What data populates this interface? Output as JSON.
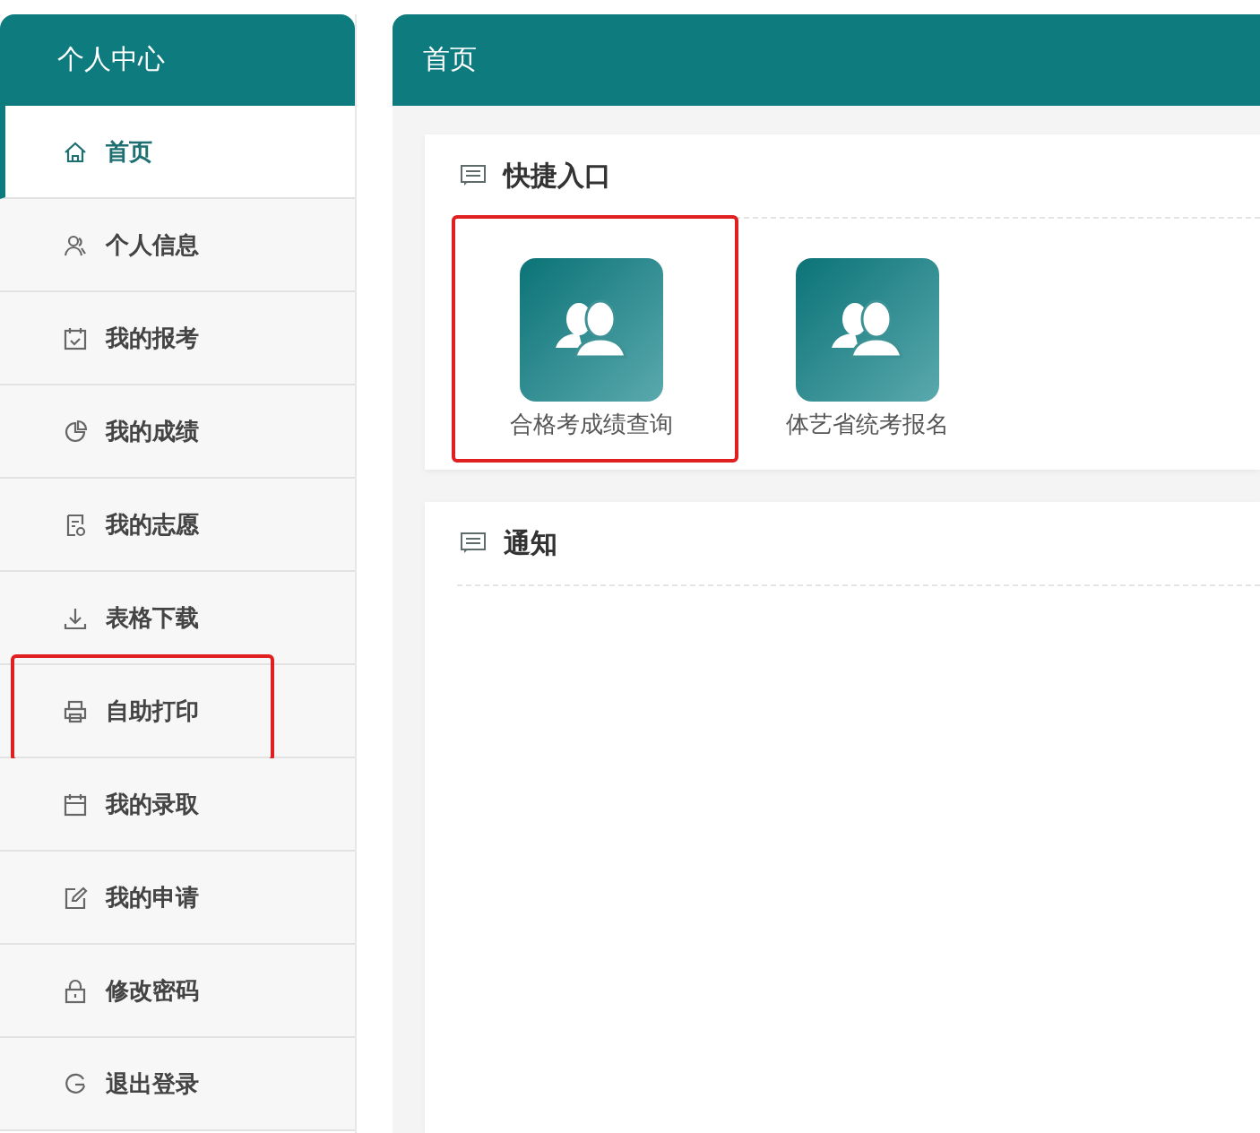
{
  "sidebar": {
    "title": "个人中心",
    "items": [
      {
        "label": "首页",
        "selected": true,
        "highlighted": false
      },
      {
        "label": "个人信息",
        "selected": false,
        "highlighted": false
      },
      {
        "label": "我的报考",
        "selected": false,
        "highlighted": false
      },
      {
        "label": "我的成绩",
        "selected": false,
        "highlighted": false
      },
      {
        "label": "我的志愿",
        "selected": false,
        "highlighted": false
      },
      {
        "label": "表格下载",
        "selected": false,
        "highlighted": false
      },
      {
        "label": "自助打印",
        "selected": false,
        "highlighted": true
      },
      {
        "label": "我的录取",
        "selected": false,
        "highlighted": false
      },
      {
        "label": "我的申请",
        "selected": false,
        "highlighted": false
      },
      {
        "label": "修改密码",
        "selected": false,
        "highlighted": false
      },
      {
        "label": "退出登录",
        "selected": false,
        "highlighted": false
      }
    ]
  },
  "main": {
    "title": "首页",
    "quick_entry": {
      "title": "快捷入口",
      "tiles": [
        {
          "label": "合格考成绩查询",
          "highlighted": true
        },
        {
          "label": "体艺省统考报名",
          "highlighted": false
        }
      ]
    },
    "notice": {
      "title": "通知"
    }
  }
}
